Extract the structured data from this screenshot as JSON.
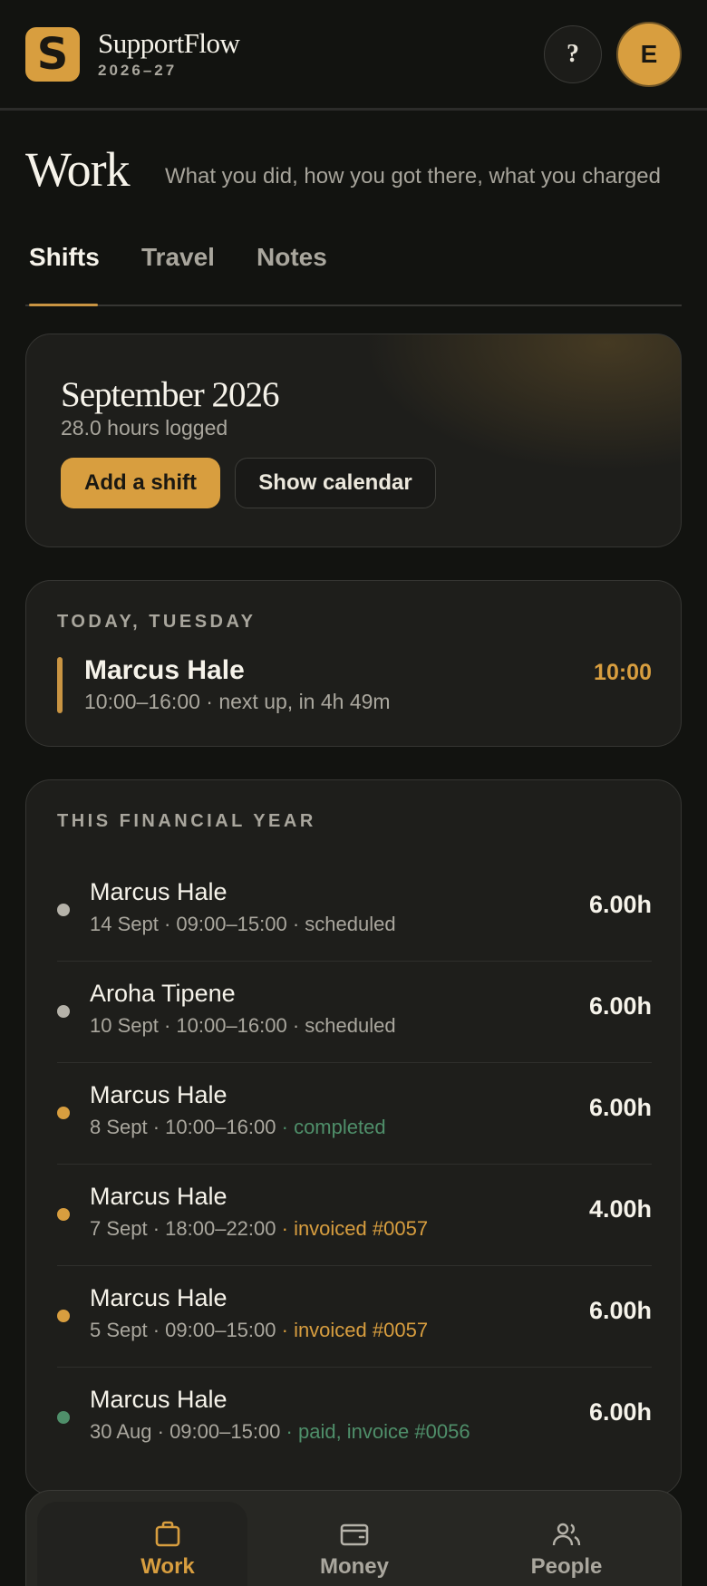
{
  "app": {
    "logo_letter": "S",
    "name": "SupportFlow",
    "year": "2026–27",
    "help_label": "?",
    "avatar_initial": "E"
  },
  "page": {
    "title": "Work",
    "subtitle": "What you did, how you got there, what you charged"
  },
  "tabs": [
    {
      "label": "Shifts",
      "active": true
    },
    {
      "label": "Travel",
      "active": false
    },
    {
      "label": "Notes",
      "active": false
    }
  ],
  "month_card": {
    "title": "September 2026",
    "hours": "28.0 hours logged",
    "add_label": "Add a shift",
    "calendar_label": "Show calendar"
  },
  "today": {
    "label": "TODAY, TUESDAY",
    "name": "Marcus Hale",
    "detail": "10:00–16:00 · next up, in 4h 49m",
    "time": "10:00"
  },
  "year": {
    "label": "THIS FINANCIAL YEAR",
    "rows": [
      {
        "name": "Marcus Hale",
        "meta": "14 Sept · 09:00–15:00 · ",
        "status": "scheduled",
        "hours": "6.00h"
      },
      {
        "name": "Aroha Tipene",
        "meta": "10 Sept · 10:00–16:00 · ",
        "status": "scheduled",
        "hours": "6.00h"
      },
      {
        "name": "Marcus Hale",
        "meta": "8 Sept · 10:00–16:00 ",
        "status": "· completed",
        "hours": "6.00h"
      },
      {
        "name": "Marcus Hale",
        "meta": "7 Sept · 18:00–22:00 ",
        "status": "· invoiced #0057",
        "hours": "4.00h"
      },
      {
        "name": "Marcus Hale",
        "meta": "5 Sept · 09:00–15:00 ",
        "status": "· invoiced #0057",
        "hours": "6.00h"
      },
      {
        "name": "Marcus Hale",
        "meta": "30 Aug · 09:00–15:00 ",
        "status": "· paid, invoice #0056",
        "hours": "6.00h"
      }
    ]
  },
  "status_colors": {
    "scheduled": "#b5b2a9",
    "completed": "#4f8f6a",
    "invoiced": "#d89e3f",
    "paid": "#4f8f6a"
  },
  "nav": [
    {
      "label": "Work",
      "icon": "briefcase-icon",
      "active": true
    },
    {
      "label": "Money",
      "icon": "wallet-icon",
      "active": false
    },
    {
      "label": "People",
      "icon": "people-icon",
      "active": false
    }
  ]
}
